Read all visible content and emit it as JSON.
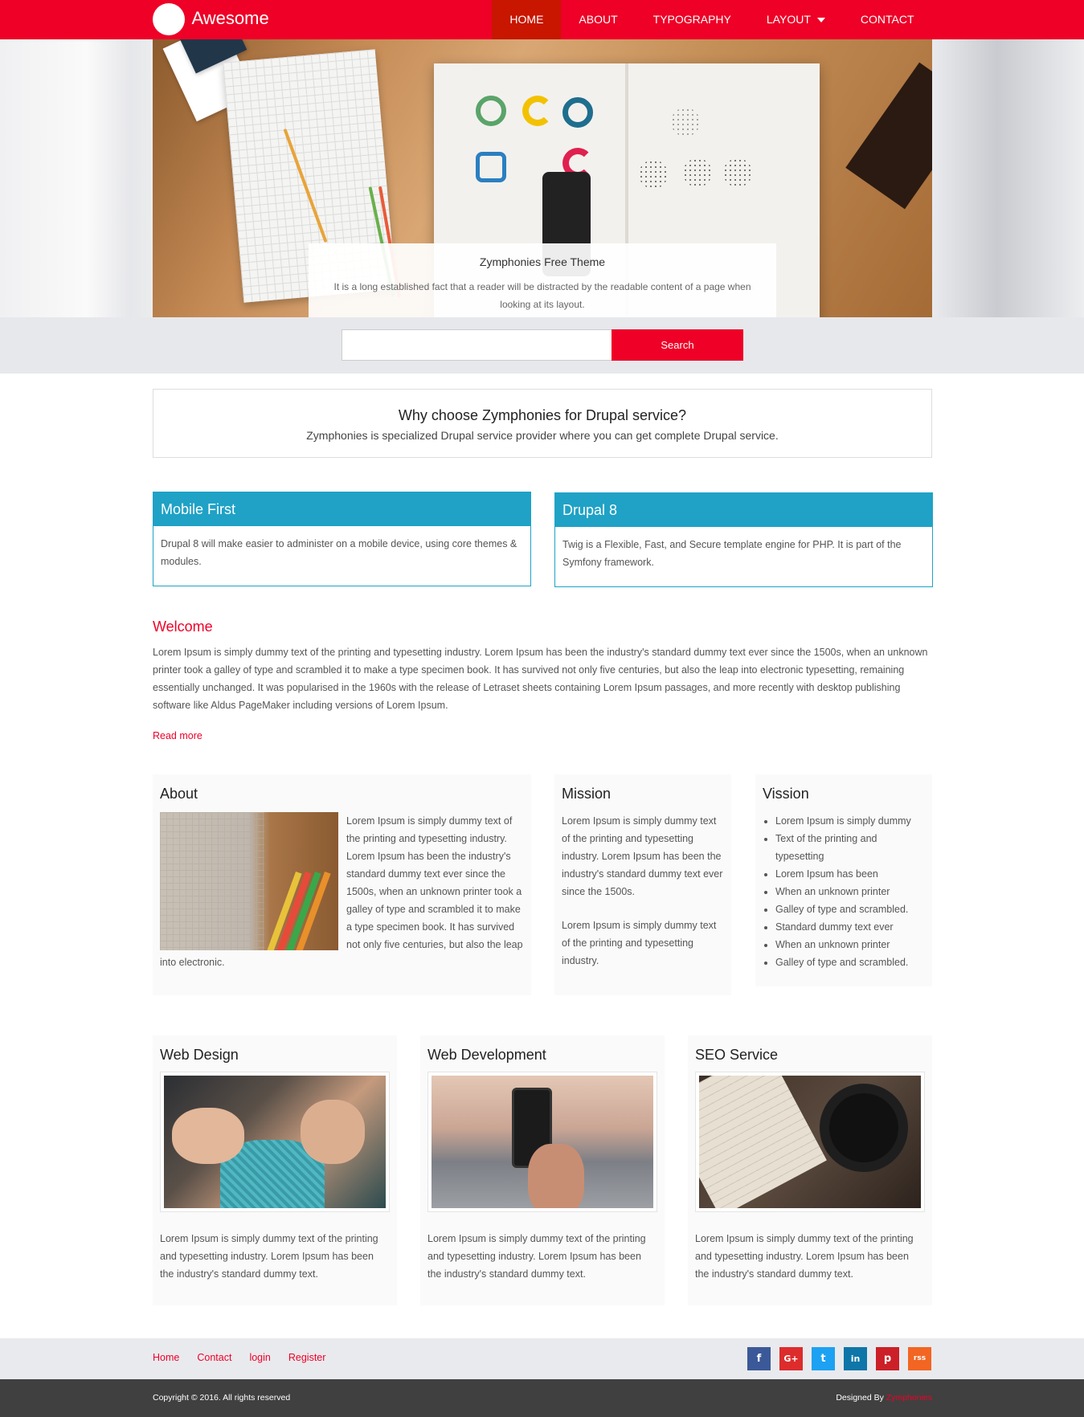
{
  "header": {
    "logo_text": "Awesome",
    "nav": [
      {
        "label": "HOME",
        "active": true
      },
      {
        "label": "ABOUT",
        "active": false
      },
      {
        "label": "TYPOGRAPHY",
        "active": false
      },
      {
        "label": "LAYOUT",
        "active": false,
        "has_dropdown": true
      },
      {
        "label": "CONTACT",
        "active": false
      }
    ],
    "accent_color": "#ee0027"
  },
  "hero": {
    "caption_title": "Zymphonies Free Theme",
    "caption_text": "It is a long established fact that a reader will be distracted by the readable content of a page when looking at its layout.",
    "slides": 2,
    "active_slide": 2
  },
  "search": {
    "placeholder": "",
    "value": "",
    "button_label": "Search"
  },
  "why": {
    "title": "Why choose Zymphonies for Drupal service?",
    "subtitle": "Zymphonies is specialized Drupal service provider where you can get complete Drupal service."
  },
  "features": [
    {
      "title": "Mobile First",
      "text": "Drupal 8 will make easier to administer on a mobile device, using core themes & modules."
    },
    {
      "title": "Drupal 8",
      "text": "Twig is a Flexible, Fast, and Secure template engine for PHP. It is part of the Symfony framework."
    }
  ],
  "welcome": {
    "title": "Welcome",
    "text": "Lorem Ipsum is simply dummy text of the printing and typesetting industry. Lorem Ipsum has been the industry's standard dummy text ever since the 1500s, when an unknown printer took a galley of type and scrambled it to make a type specimen book. It has survived not only five centuries, but also the leap into electronic typesetting, remaining essentially unchanged. It was popularised in the 1960s with the release of Letraset sheets containing Lorem Ipsum passages, and more recently with desktop publishing software like Aldus PageMaker including versions of Lorem Ipsum.",
    "read_more": "Read more"
  },
  "about": {
    "title": "About",
    "text": "Lorem Ipsum is simply dummy text of the printing and typesetting industry. Lorem Ipsum has been the industry's standard dummy text ever since the 1500s, when an unknown printer took a galley of type and scrambled it to make a type specimen book. It has survived not only five centuries, but also the leap into electronic."
  },
  "mission": {
    "title": "Mission",
    "para1": "Lorem Ipsum is simply dummy text of the printing and typesetting industry. Lorem Ipsum has been the industry's standard dummy text ever since the 1500s.",
    "para2": "Lorem Ipsum is simply dummy text of the printing and typesetting industry."
  },
  "vission": {
    "title": "Vission",
    "items": [
      "Lorem Ipsum is simply dummy",
      "Text of the printing and typesetting",
      "Lorem Ipsum has been",
      "When an unknown printer",
      "Galley of type and scrambled.",
      "Standard dummy text ever",
      "When an unknown printer",
      "Galley of type and scrambled."
    ]
  },
  "services": [
    {
      "title": "Web Design",
      "text": "Lorem Ipsum is simply dummy text of the printing and typesetting industry. Lorem Ipsum has been the industry's standard dummy text."
    },
    {
      "title": "Web Development",
      "text": "Lorem Ipsum is simply dummy text of the printing and typesetting industry. Lorem Ipsum has been the industry's standard dummy text."
    },
    {
      "title": "SEO Service",
      "text": "Lorem Ipsum is simply dummy text of the printing and typesetting industry. Lorem Ipsum has been the industry's standard dummy text."
    }
  ],
  "footer": {
    "links": [
      "Home",
      "Contact",
      "login",
      "Register"
    ],
    "social": [
      {
        "icon": "facebook-icon",
        "glyph": "f",
        "color": "#3b5998"
      },
      {
        "icon": "google-plus-icon",
        "glyph": "G+",
        "color": "#dd2c2c"
      },
      {
        "icon": "twitter-icon",
        "glyph": "t",
        "color": "#1da1f2"
      },
      {
        "icon": "linkedin-icon",
        "glyph": "in",
        "color": "#0e76a8"
      },
      {
        "icon": "pinterest-icon",
        "glyph": "p",
        "color": "#cb2027"
      },
      {
        "icon": "rss-icon",
        "glyph": "rss",
        "color": "#f26522"
      }
    ],
    "copyright": "Copyright © 2016. All rights reserved",
    "designed_by_label": "Designed By",
    "designed_by_brand": "Zymphonies"
  }
}
